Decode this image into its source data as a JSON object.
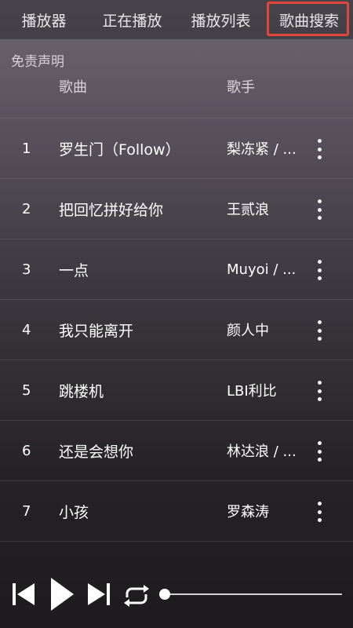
{
  "tabs": [
    {
      "label": "播放器",
      "active": false
    },
    {
      "label": "正在播放",
      "active": false
    },
    {
      "label": "播放列表",
      "active": false
    },
    {
      "label": "歌曲搜索",
      "active": true
    }
  ],
  "disclaimer": "免责声明",
  "table": {
    "headers": {
      "song": "歌曲",
      "artist": "歌手"
    },
    "rows": [
      {
        "index": "1",
        "title": "罗生门（Follow）",
        "artist": "梨冻紧 / ..."
      },
      {
        "index": "2",
        "title": "把回忆拼好给你",
        "artist": "王贰浪"
      },
      {
        "index": "3",
        "title": "一点",
        "artist": "Muyoi / ..."
      },
      {
        "index": "4",
        "title": "我只能离开",
        "artist": "颜人中"
      },
      {
        "index": "5",
        "title": "跳楼机",
        "artist": "LBI利比"
      },
      {
        "index": "6",
        "title": "还是会想你",
        "artist": "林达浪 / ..."
      },
      {
        "index": "7",
        "title": "小孩",
        "artist": "罗森涛"
      }
    ]
  },
  "player": {
    "icons": [
      "skip-previous-icon",
      "play-icon",
      "skip-next-icon",
      "repeat-icon"
    ],
    "progress": 0
  },
  "colors": {
    "accent": "#e0473c"
  }
}
